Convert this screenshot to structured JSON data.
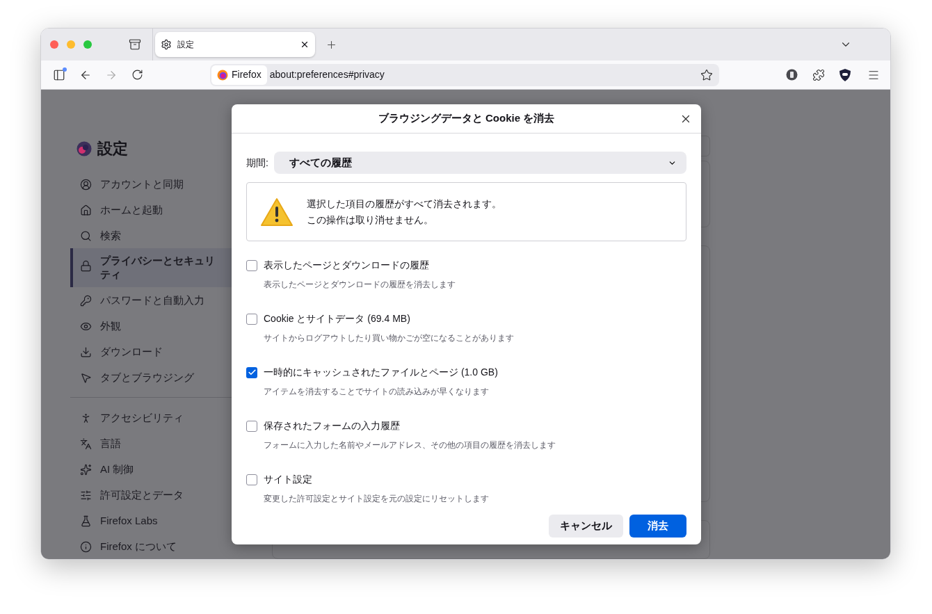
{
  "window": {
    "controls": [
      {
        "color": "#ff5f57"
      },
      {
        "color": "#febc2e"
      },
      {
        "color": "#28c840"
      }
    ]
  },
  "tabs": [
    {
      "label": "設定",
      "selected": true
    }
  ],
  "toolbar": {
    "identity": "Firefox",
    "url": "about:preferences#privacy"
  },
  "sidebar": {
    "title": "設定",
    "sections": [
      {
        "items": [
          {
            "label": "アカウントと同期",
            "selected": false
          },
          {
            "label": "ホームと起動",
            "selected": false
          },
          {
            "label": "検索",
            "selected": false
          },
          {
            "label": "プライバシーとセキュリティ",
            "selected": true
          },
          {
            "label": "パスワードと自動入力",
            "selected": false
          },
          {
            "label": "外観",
            "selected": false
          },
          {
            "label": "ダウンロード",
            "selected": false
          },
          {
            "label": "タブとブラウジング",
            "selected": false
          }
        ]
      },
      {
        "items": [
          {
            "label": "アクセシビリティ",
            "selected": false
          },
          {
            "label": "言語",
            "selected": false
          },
          {
            "label": "AI 制御",
            "selected": false
          },
          {
            "label": "許可設定とデータ",
            "selected": false
          },
          {
            "label": "Firefox Labs",
            "selected": false
          },
          {
            "label": "Firefox について",
            "selected": false
          }
        ]
      }
    ]
  },
  "dialog": {
    "title": "ブラウジングデータと Cookie を消去",
    "period_label": "期間:",
    "period_value": "すべての履歴",
    "warning": [
      "選択した項目の履歴がすべて消去されます。",
      "この操作は取り消せません。"
    ],
    "options": [
      {
        "label": "表示したページとダウンロードの履歴",
        "description": "表示したページとダウンロードの履歴を消去します",
        "checked": false
      },
      {
        "label": "Cookie とサイトデータ (69.4 MB)",
        "description": "サイトからログアウトしたり買い物かごが空になることがあります",
        "checked": false
      },
      {
        "label": "一時的にキャッシュされたファイルとページ (1.0 GB)",
        "description": "アイテムを消去することでサイトの読み込みが早くなります",
        "checked": true
      },
      {
        "label": "保存されたフォームの入力履歴",
        "description": "フォームに入力した名前やメールアドレス、その他の項目の履歴を消去します",
        "checked": false
      },
      {
        "label": "サイト設定",
        "description": "変更した許可設定とサイト設定を元の設定にリセットします",
        "checked": false
      }
    ],
    "buttons": [
      {
        "label": "キャンセル",
        "kind": "secondary"
      },
      {
        "label": "消去",
        "kind": "primary"
      }
    ]
  }
}
